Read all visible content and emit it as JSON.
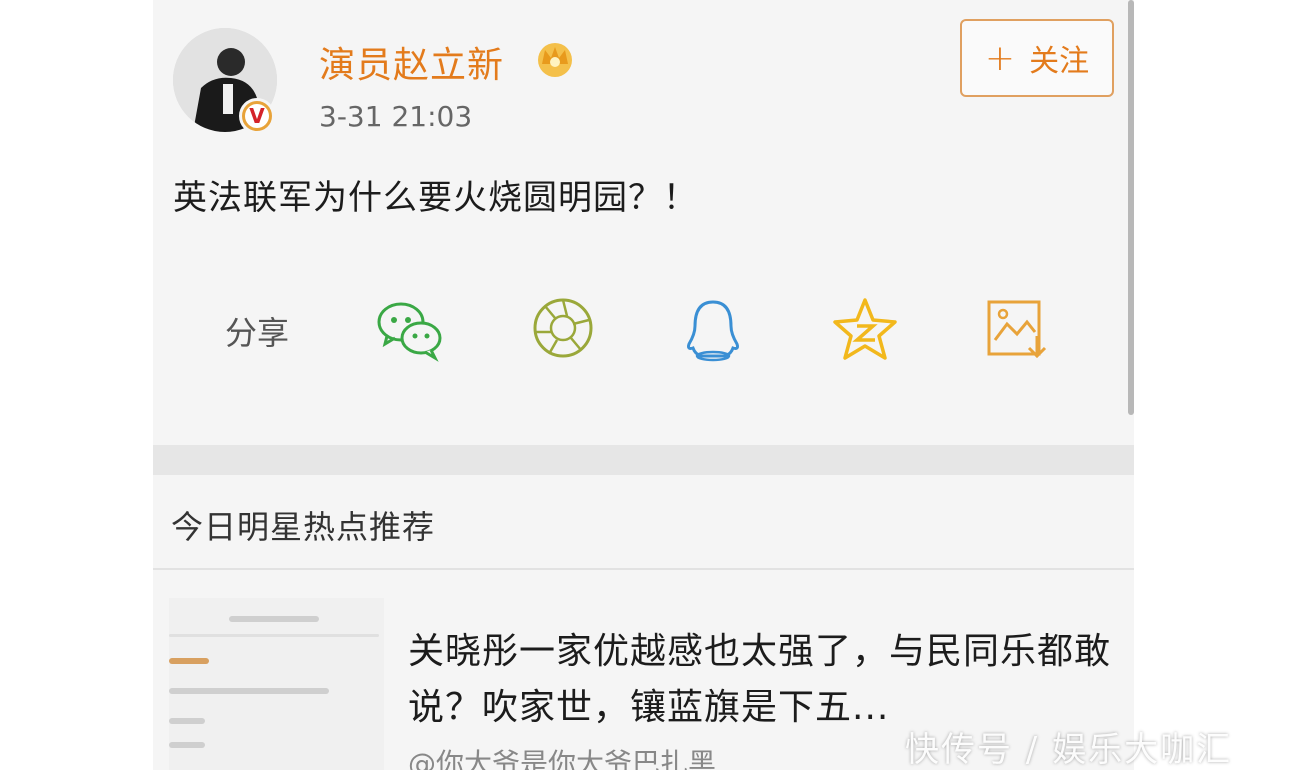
{
  "post": {
    "username": "演员赵立新",
    "timestamp": "3-31 21:03",
    "text": "英法联军为什么要火烧圆明园？！",
    "follow_label": "关注",
    "follow_plus": "+",
    "verified_badge": "V"
  },
  "share": {
    "label": "分享",
    "icons": [
      "wechat-icon",
      "moments-icon",
      "qq-icon",
      "qzone-icon",
      "save-image-icon"
    ]
  },
  "recommend": {
    "title": "今日明星热点推荐",
    "headline": "关晓彤一家优越感也太强了，与民同乐都敢说？吹家世，镶蓝旗是下五...",
    "source": "@你大爷是你大爷巴扎黑"
  },
  "watermark": "快传号 / 娱乐大咖汇",
  "colors": {
    "accent": "#e37b1c",
    "wechat": "#3aa845",
    "moments": "#9aa83a",
    "qq": "#3a8fd4",
    "qzone": "#f2b81c"
  }
}
